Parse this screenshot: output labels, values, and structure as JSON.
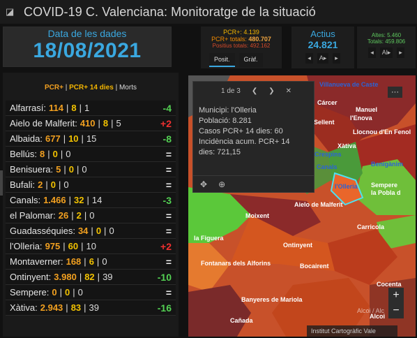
{
  "app": {
    "title": "COVID-19 C. Valenciana: Monitoratge de la situació"
  },
  "date_card": {
    "label": "Data de les dades",
    "value": "18/08/2021"
  },
  "pcr_card": {
    "pcr": "PCR+: 4.139",
    "pcr_totals_label": "PCR+ totals:",
    "pcr_totals_value": "480.707",
    "positius_totals": "Positius totals: 492.162",
    "tabs": [
      "Posit.",
      "Gràf."
    ]
  },
  "actius_card": {
    "label": "Actius",
    "value": "24.821",
    "nav": [
      "◂",
      "A▸",
      "▸"
    ]
  },
  "altes_card": {
    "altes": "Altes: 5.460",
    "totals": "Totals: 459.806",
    "nav": [
      "◂",
      "Al▸",
      "▸"
    ]
  },
  "list": {
    "header": {
      "pcr": "PCR+",
      "pcr14": "PCR+ 14 dies",
      "morts": "Morts"
    },
    "rows": [
      {
        "name": "Alfarrasí:",
        "pcr": "114",
        "p14": "8",
        "morts": "1",
        "delta": "-4",
        "kind": "neg"
      },
      {
        "name": "Aielo de Malferit:",
        "pcr": "410",
        "p14": "8",
        "morts": "5",
        "delta": "+2",
        "kind": "pos"
      },
      {
        "name": "Albaida:",
        "pcr": "677",
        "p14": "10",
        "morts": "15",
        "delta": "-8",
        "kind": "neg"
      },
      {
        "name": "Bellús:",
        "pcr": "8",
        "p14": "0",
        "morts": "0",
        "delta": "=",
        "kind": "eq"
      },
      {
        "name": "Benisuera:",
        "pcr": "5",
        "p14": "0",
        "morts": "0",
        "delta": "=",
        "kind": "eq"
      },
      {
        "name": "Bufali:",
        "pcr": "2",
        "p14": "0",
        "morts": "0",
        "delta": "=",
        "kind": "eq"
      },
      {
        "name": "Canals:",
        "pcr": "1.466",
        "p14": "32",
        "morts": "14",
        "delta": "-3",
        "kind": "neg"
      },
      {
        "name": "el Palomar:",
        "pcr": "26",
        "p14": "2",
        "morts": "0",
        "delta": "=",
        "kind": "eq"
      },
      {
        "name": "Guadasséquies:",
        "pcr": "34",
        "p14": "0",
        "morts": "0",
        "delta": "=",
        "kind": "eq"
      },
      {
        "name": "l'Olleria:",
        "pcr": "975",
        "p14": "60",
        "morts": "10",
        "delta": "+2",
        "kind": "pos"
      },
      {
        "name": "Montaverner:",
        "pcr": "168",
        "p14": "6",
        "morts": "0",
        "delta": "=",
        "kind": "eq"
      },
      {
        "name": "Ontinyent:",
        "pcr": "3.980",
        "p14": "82",
        "morts": "39",
        "delta": "-10",
        "kind": "neg"
      },
      {
        "name": "Sempere:",
        "pcr": "0",
        "p14": "0",
        "morts": "0",
        "delta": "=",
        "kind": "eq"
      },
      {
        "name": "Xàtiva:",
        "pcr": "2.943",
        "p14": "83",
        "morts": "39",
        "delta": "-16",
        "kind": "neg"
      }
    ]
  },
  "popup": {
    "pager": "1 de 3",
    "lines": [
      "Municipi: l'Olleria",
      "Població: 8.281",
      "Casos PCR+ 14 dies: 60",
      "Incidència acum. PCR+ 14",
      "dies: 721,15"
    ]
  },
  "map": {
    "labels": [
      {
        "text": "Villanueva de Caste",
        "kind": "blue"
      },
      {
        "text": "Cárcer",
        "kind": "white"
      },
      {
        "text": "Manuel",
        "kind": "white"
      },
      {
        "text": "l'Enova",
        "kind": "white"
      },
      {
        "text": "Sellent",
        "kind": "white"
      },
      {
        "text": "Llocnou d'En Fenol",
        "kind": "white"
      },
      {
        "text": "Xàtiva",
        "kind": "white"
      },
      {
        "text": "de Crespins",
        "kind": "blue"
      },
      {
        "text": "Canals",
        "kind": "blue"
      },
      {
        "text": "Benigànim",
        "kind": "blue"
      },
      {
        "text": "l'Olleria",
        "kind": "blue"
      },
      {
        "text": "Sempere",
        "kind": "white"
      },
      {
        "text": "la Pobla d",
        "kind": "white"
      },
      {
        "text": "Moixent",
        "kind": "white"
      },
      {
        "text": "Aielo de Malferit",
        "kind": "white"
      },
      {
        "text": "Carricola",
        "kind": "white"
      },
      {
        "text": "Ontinyent",
        "kind": "white"
      },
      {
        "text": "la Figuera",
        "kind": "white"
      },
      {
        "text": "Fontanars dels Alforins",
        "kind": "white"
      },
      {
        "text": "Bocairent",
        "kind": "white"
      },
      {
        "text": "Cocenta",
        "kind": "white"
      },
      {
        "text": "Banyeres de Mariola",
        "kind": "white"
      },
      {
        "text": "Cañada",
        "kind": "white"
      },
      {
        "text": "Alcoi",
        "kind": "white"
      }
    ],
    "attribution": "Institut Cartogràfic Vale",
    "watermark": "Alcoi / Alc"
  },
  "colors": {
    "accent": "#3aa8e0",
    "pcr": "#f2a020",
    "pcr14": "#f2c200",
    "good": "#53d053",
    "bad": "#f03030"
  }
}
